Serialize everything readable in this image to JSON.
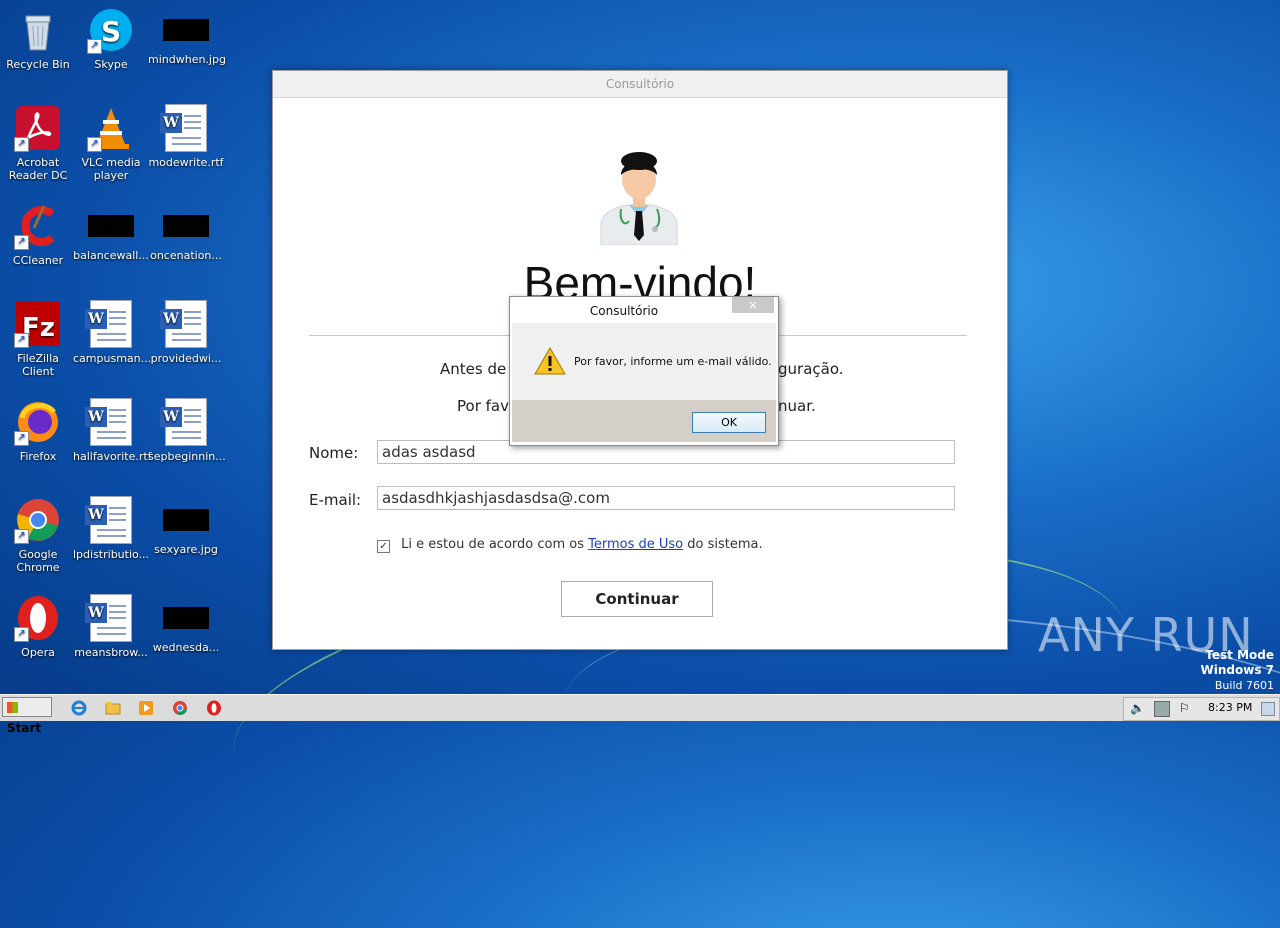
{
  "desktop": {
    "icons": [
      {
        "label": "Recycle Bin"
      },
      {
        "label": "Skype"
      },
      {
        "label": "mindwhen.jpg"
      },
      {
        "label": "Acrobat Reader DC"
      },
      {
        "label": "VLC media player"
      },
      {
        "label": "modewrite.rtf"
      },
      {
        "label": "CCleaner"
      },
      {
        "label": "balancewall..."
      },
      {
        "label": "oncenation..."
      },
      {
        "label": "FileZilla Client"
      },
      {
        "label": "campusman..."
      },
      {
        "label": "providedwi..."
      },
      {
        "label": "Firefox"
      },
      {
        "label": "hallfavorite.rtf"
      },
      {
        "label": "sepbeginnin..."
      },
      {
        "label": "Google Chrome"
      },
      {
        "label": "lpdistributio..."
      },
      {
        "label": "sexyare.jpg"
      },
      {
        "label": "Opera"
      },
      {
        "label": "meansbrow..."
      },
      {
        "label": "wednesda..."
      }
    ]
  },
  "app": {
    "title": "Consultório",
    "welcome": "Bem-vindo!",
    "intro_line1_left": "Antes de c",
    "intro_line1_right": "guração.",
    "intro_line2_left": "Por fave",
    "intro_line2_right": "nuar.",
    "name_label": "Nome:",
    "name_value": "adas asdasd",
    "email_label": "E-mail:",
    "email_value": "asdasdhkjashjasdasdsa@.com",
    "terms_prefix": "Li e estou de acordo com os",
    "terms_link": "Termos de Uso",
    "terms_suffix": "do sistema.",
    "terms_checked": true,
    "continue_label": "Continuar"
  },
  "dialog": {
    "title": "Consultório",
    "close": "×",
    "message": "Por favor, informe um e-mail válido.",
    "ok_label": "OK"
  },
  "watermark": {
    "text": "ANY RUN",
    "mode_line1": "Test Mode",
    "mode_line2": "Windows 7",
    "mode_line3": "Build 7601"
  },
  "taskbar": {
    "start_label": "Start",
    "clock": "8:23 PM"
  },
  "colors": {
    "desktop_blue": "#1a6fc9",
    "link": "#1a3fbf"
  }
}
